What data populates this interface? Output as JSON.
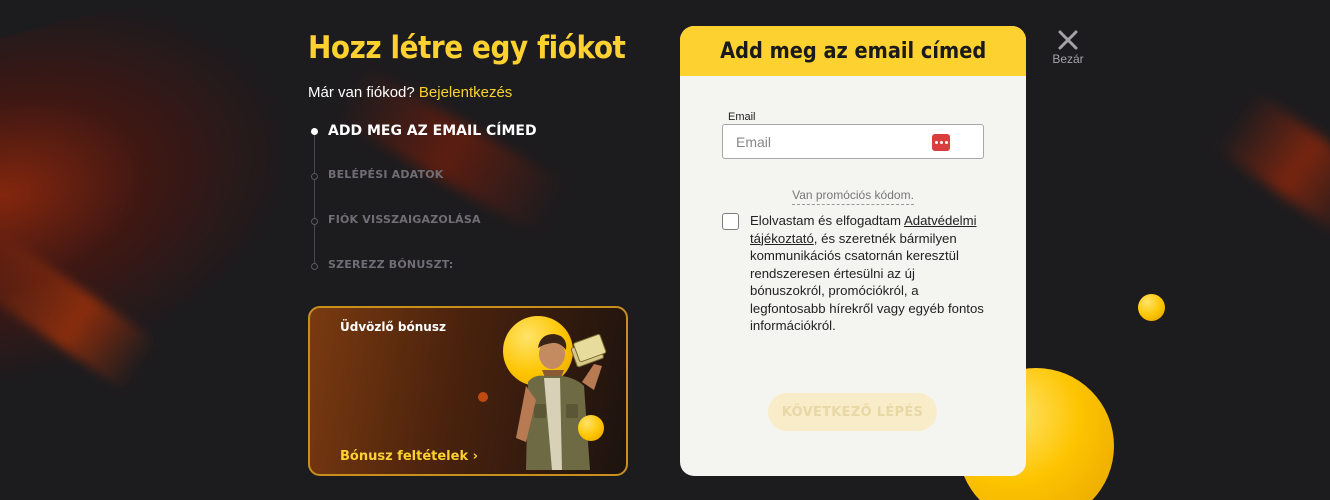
{
  "header": {
    "title": "Hozz létre egy fiókot",
    "have_account": "Már van fiókod?",
    "login_link": "Bejelentkezés"
  },
  "steps": [
    {
      "label": "ADD MEG AZ EMAIL CÍMED",
      "active": true
    },
    {
      "label": "BELÉPÉSI ADATOK",
      "active": false
    },
    {
      "label": "FIÓK VISSZAIGAZOLÁSA",
      "active": false
    },
    {
      "label": "SZEREZZ BÓNUSZT:",
      "active": false
    }
  ],
  "bonus": {
    "title": "Üdvözlő bónusz",
    "link": "Bónusz feltételek ›"
  },
  "form": {
    "title": "Add meg az email címed",
    "email_label": "Email",
    "email_placeholder": "Email",
    "email_value": "",
    "promo_link": "Van promóciós kódom.",
    "consent_before": "Elolvastam és elfogadtam",
    "consent_link": "Adatvédelmi tájékoztató",
    "consent_after": ", és szeretnék bármilyen kommunikációs csatornán keresztül rendszeresen értesülni az új bónuszokról, promóciókról, a legfontosabb hírekről vagy egyéb fontos információkról.",
    "next_button": "KÖVETKEZŐ LÉPÉS"
  },
  "close": {
    "label": "Bezár"
  },
  "colors": {
    "accent": "#fdd12f",
    "background": "#1c1b1e",
    "panel": "#f4f4f1"
  },
  "icons": [
    "close-icon",
    "password-manager-icon"
  ]
}
